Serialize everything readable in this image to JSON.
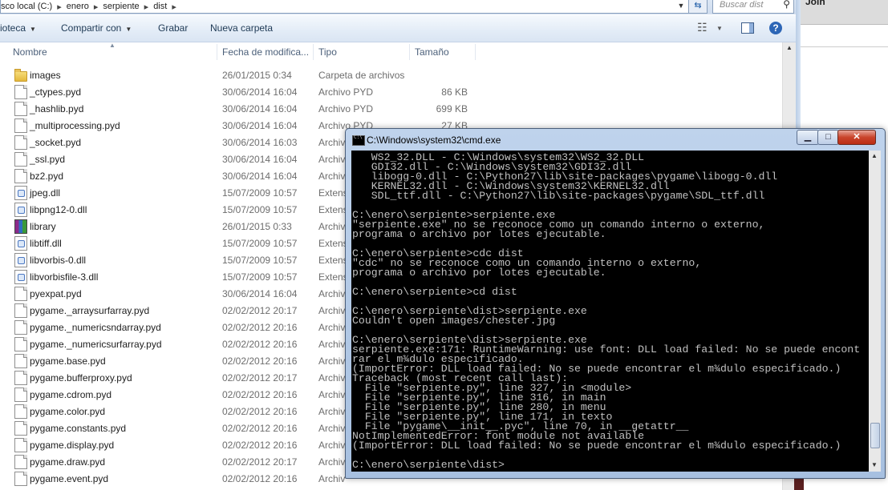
{
  "explorer": {
    "address": {
      "crumbs": [
        "sco local (C:)",
        "enero",
        "serpiente",
        "dist"
      ]
    },
    "search": {
      "placeholder": "Buscar dist"
    },
    "toolbar": {
      "biblioteca": "ioteca",
      "compartir": "Compartir con",
      "grabar": "Grabar",
      "nueva_carpeta": "Nueva carpeta"
    },
    "columns": {
      "name": "Nombre",
      "date": "Fecha de modifica...",
      "type": "Tipo",
      "size": "Tamaño"
    },
    "files": [
      {
        "name": "images",
        "date": "26/01/2015 0:34",
        "type": "Carpeta de archivos",
        "size": "",
        "icon": "folder-icon"
      },
      {
        "name": "_ctypes.pyd",
        "date": "30/06/2014 16:04",
        "type": "Archivo PYD",
        "size": "86 KB",
        "icon": "file-icon"
      },
      {
        "name": "_hashlib.pyd",
        "date": "30/06/2014 16:04",
        "type": "Archivo PYD",
        "size": "699 KB",
        "icon": "file-icon"
      },
      {
        "name": "_multiprocessing.pyd",
        "date": "30/06/2014 16:04",
        "type": "Archivo PYD",
        "size": "27 KB",
        "icon": "file-icon"
      },
      {
        "name": "_socket.pyd",
        "date": "30/06/2014 16:03",
        "type": "Archiv",
        "size": "",
        "icon": "file-icon"
      },
      {
        "name": "_ssl.pyd",
        "date": "30/06/2014 16:04",
        "type": "Archiv",
        "size": "",
        "icon": "file-icon"
      },
      {
        "name": "bz2.pyd",
        "date": "30/06/2014 16:04",
        "type": "Archiv",
        "size": "",
        "icon": "file-icon"
      },
      {
        "name": "jpeg.dll",
        "date": "15/07/2009 10:57",
        "type": "Extens",
        "size": "",
        "icon": "dll-icon"
      },
      {
        "name": "libpng12-0.dll",
        "date": "15/07/2009 10:57",
        "type": "Extens",
        "size": "",
        "icon": "dll-icon"
      },
      {
        "name": "library",
        "date": "26/01/2015 0:33",
        "type": "Archiv",
        "size": "",
        "icon": "library-archive-icon"
      },
      {
        "name": "libtiff.dll",
        "date": "15/07/2009 10:57",
        "type": "Extens",
        "size": "",
        "icon": "dll-icon"
      },
      {
        "name": "libvorbis-0.dll",
        "date": "15/07/2009 10:57",
        "type": "Extens",
        "size": "",
        "icon": "dll-icon"
      },
      {
        "name": "libvorbisfile-3.dll",
        "date": "15/07/2009 10:57",
        "type": "Extens",
        "size": "",
        "icon": "dll-icon"
      },
      {
        "name": "pyexpat.pyd",
        "date": "30/06/2014 16:04",
        "type": "Archiv",
        "size": "",
        "icon": "file-icon"
      },
      {
        "name": "pygame._arraysurfarray.pyd",
        "date": "02/02/2012 20:17",
        "type": "Archiv",
        "size": "",
        "icon": "file-icon"
      },
      {
        "name": "pygame._numericsndarray.pyd",
        "date": "02/02/2012 20:16",
        "type": "Archiv",
        "size": "",
        "icon": "file-icon"
      },
      {
        "name": "pygame._numericsurfarray.pyd",
        "date": "02/02/2012 20:16",
        "type": "Archiv",
        "size": "",
        "icon": "file-icon"
      },
      {
        "name": "pygame.base.pyd",
        "date": "02/02/2012 20:16",
        "type": "Archiv",
        "size": "",
        "icon": "file-icon"
      },
      {
        "name": "pygame.bufferproxy.pyd",
        "date": "02/02/2012 20:17",
        "type": "Archiv",
        "size": "",
        "icon": "file-icon"
      },
      {
        "name": "pygame.cdrom.pyd",
        "date": "02/02/2012 20:16",
        "type": "Archiv",
        "size": "",
        "icon": "file-icon"
      },
      {
        "name": "pygame.color.pyd",
        "date": "02/02/2012 20:16",
        "type": "Archiv",
        "size": "",
        "icon": "file-icon"
      },
      {
        "name": "pygame.constants.pyd",
        "date": "02/02/2012 20:16",
        "type": "Archiv",
        "size": "",
        "icon": "file-icon"
      },
      {
        "name": "pygame.display.pyd",
        "date": "02/02/2012 20:16",
        "type": "Archiv",
        "size": "",
        "icon": "file-icon"
      },
      {
        "name": "pygame.draw.pyd",
        "date": "02/02/2012 20:17",
        "type": "Archiv",
        "size": "",
        "icon": "file-icon"
      },
      {
        "name": "pygame.event.pyd",
        "date": "02/02/2012 20:16",
        "type": "Archiv",
        "size": "",
        "icon": "file-icon"
      }
    ]
  },
  "background_window": {
    "label": "Join"
  },
  "cmd": {
    "title": "C:\\Windows\\system32\\cmd.exe",
    "lines": [
      "   WS2_32.DLL - C:\\Windows\\system32\\WS2_32.DLL",
      "   GDI32.dll - C:\\Windows\\system32\\GDI32.dll",
      "   libogg-0.dll - C:\\Python27\\lib\\site-packages\\pygame\\libogg-0.dll",
      "   KERNEL32.dll - C:\\Windows\\system32\\KERNEL32.dll",
      "   SDL_ttf.dll - C:\\Python27\\lib\\site-packages\\pygame\\SDL_ttf.dll",
      "",
      "C:\\enero\\serpiente>serpiente.exe",
      "\"serpiente.exe\" no se reconoce como un comando interno o externo,",
      "programa o archivo por lotes ejecutable.",
      "",
      "C:\\enero\\serpiente>cdc dist",
      "\"cdc\" no se reconoce como un comando interno o externo,",
      "programa o archivo por lotes ejecutable.",
      "",
      "C:\\enero\\serpiente>cd dist",
      "",
      "C:\\enero\\serpiente\\dist>serpiente.exe",
      "Couldn't open images/chester.jpg",
      "",
      "C:\\enero\\serpiente\\dist>serpiente.exe",
      "serpiente.exe:171: RuntimeWarning: use font: DLL load failed: No se puede encont",
      "rar el m¾dulo especificado.",
      "(ImportError: DLL load failed: No se puede encontrar el m¾dulo especificado.)",
      "Traceback (most recent call last):",
      "  File \"serpiente.py\", line 327, in <module>",
      "  File \"serpiente.py\", line 316, in main",
      "  File \"serpiente.py\", line 280, in menu",
      "  File \"serpiente.py\", line 171, in texto",
      "  File \"pygame\\__init__.pyc\", line 70, in __getattr__",
      "NotImplementedError: font module not available",
      "(ImportError: DLL load failed: No se puede encontrar el m¾dulo especificado.)",
      "",
      "C:\\enero\\serpiente\\dist>"
    ]
  }
}
